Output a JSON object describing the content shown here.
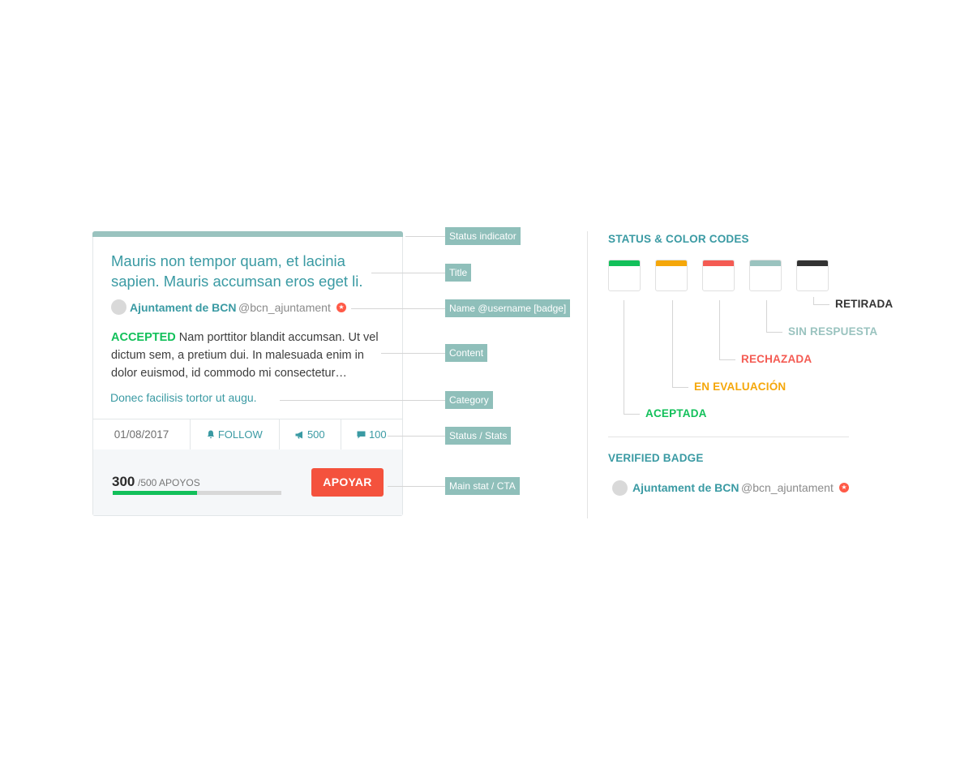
{
  "card": {
    "title": "Mauris non tempor quam, et lacinia sapien. Mauris accumsan eros eget li.",
    "author_name": "Ajuntament de BCN",
    "author_username": "@bcn_ajuntament",
    "status_word": "ACCEPTED",
    "content": "Nam porttitor blandit accumsan. Ut vel dictum sem, a pretium dui. In malesuada enim in dolor euismod, id commodo mi consectetur…",
    "category": "Donec facilisis tortor ut augu.",
    "date": "01/08/2017",
    "follow_label": "FOLLOW",
    "supports_stat": "500",
    "comments_stat": "100",
    "supports_count": "300",
    "supports_total": "/500 APOYOS",
    "progress": 0.5,
    "cta_label": "APOYAR",
    "status_color": "#9ac3bf"
  },
  "annotations": {
    "status_indicator": "Status indicator",
    "title": "Title",
    "name": "Name @username [badge]",
    "content": "Content",
    "category": "Category",
    "status_stats": "Status / Stats",
    "main_stat_cta": "Main stat / CTA"
  },
  "color_codes": {
    "title": "STATUS & COLOR CODES",
    "statuses": [
      {
        "label": "ACEPTADA",
        "color": "#12c05a"
      },
      {
        "label": "EN EVALUACIÓN",
        "color": "#f5a70a"
      },
      {
        "label": "RECHAZADA",
        "color": "#f45b53"
      },
      {
        "label": "SIN RESPUESTA",
        "color": "#9ac3bf"
      },
      {
        "label": "RETIRADA",
        "color": "#333333"
      }
    ]
  },
  "verified": {
    "title": "VERIFIED BADGE",
    "name": "Ajuntament de BCN",
    "username": "@bcn_ajuntament"
  },
  "icons": [
    "bell-icon",
    "megaphone-icon",
    "comment-icon",
    "verified-badge-icon"
  ]
}
